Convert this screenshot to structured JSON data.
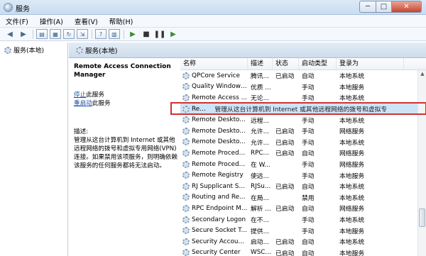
{
  "window": {
    "title": "服务",
    "min": "─",
    "max": "□",
    "close": "✕"
  },
  "menu": [
    "文件(F)",
    "操作(A)",
    "查看(V)",
    "帮助(H)"
  ],
  "toolbar": {
    "back": "◀",
    "forward": "▶",
    "start": "▶",
    "stop": "■",
    "pause": "❚❚",
    "restart": "▶"
  },
  "left_pane": {
    "node_label": "服务(本地)"
  },
  "right_pane": {
    "header": "服务(本地)"
  },
  "details": {
    "service_name": "Remote Access Connection Manager",
    "stop_link": "停止",
    "stop_suffix": "此服务",
    "restart_link": "重启动",
    "restart_suffix": "此服务",
    "desc_label": "描述:",
    "desc_text": "管理从这台计算机到 Internet 或其他远程网络的拨号和虚拟专用网络(VPN)连接。如果禁用该项服务，则明确依赖该服务的任何服务都将无法启动。"
  },
  "columns": [
    "名称",
    "描述",
    "状态",
    "启动类型",
    "登录为"
  ],
  "services": [
    {
      "name": "QPCore Service",
      "desc": "腾讯...",
      "status": "已启动",
      "startup": "自动",
      "login": "本地系统"
    },
    {
      "name": "Quality Windows...",
      "desc": "优质 ...",
      "status": "",
      "startup": "手动",
      "login": "本地服务"
    },
    {
      "name": "Remote Access ...",
      "desc": "无论...",
      "status": "",
      "startup": "手动",
      "login": "本地系统"
    },
    {
      "name": "Remote Access ...",
      "desc": "管理从这台计算机到 Internet 或其他远程网络的拨号和虚拟专",
      "status": "",
      "startup": "",
      "login": ""
    },
    {
      "name": "Remote Deskto...",
      "desc": "远程...",
      "status": "",
      "startup": "手动",
      "login": "本地系统"
    },
    {
      "name": "Remote Deskto...",
      "desc": "允许...",
      "status": "已启动",
      "startup": "手动",
      "login": "网络服务"
    },
    {
      "name": "Remote Deskto...",
      "desc": "允许...",
      "status": "已启动",
      "startup": "手动",
      "login": "本地系统"
    },
    {
      "name": "Remote Procedu...",
      "desc": "RPC...",
      "status": "已启动",
      "startup": "自动",
      "login": "网络服务"
    },
    {
      "name": "Remote Procedu...",
      "desc": "在 W...",
      "status": "",
      "startup": "手动",
      "login": "网络服务"
    },
    {
      "name": "Remote Registry",
      "desc": "使远...",
      "status": "",
      "startup": "手动",
      "login": "本地服务"
    },
    {
      "name": "RJ Supplicant Se...",
      "desc": "RJSu...",
      "status": "已启动",
      "startup": "自动",
      "login": "本地系统"
    },
    {
      "name": "Routing and Re...",
      "desc": "在局...",
      "status": "",
      "startup": "禁用",
      "login": "本地系统"
    },
    {
      "name": "RPC Endpoint M...",
      "desc": "解析 ...",
      "status": "已启动",
      "startup": "自动",
      "login": "网络服务"
    },
    {
      "name": "Secondary Logon",
      "desc": "在不...",
      "status": "",
      "startup": "手动",
      "login": "本地系统"
    },
    {
      "name": "Secure Socket T...",
      "desc": "提供...",
      "status": "",
      "startup": "手动",
      "login": "本地服务"
    },
    {
      "name": "Security Account...",
      "desc": "启动...",
      "status": "已启动",
      "startup": "自动",
      "login": "本地系统"
    },
    {
      "name": "Security Center",
      "desc": "WSC...",
      "status": "已启动",
      "startup": "自动",
      "login": "本地服务"
    }
  ],
  "colors": {
    "selection": "#cfe3f8",
    "highlight_border": "#cc3333",
    "link": "#1a4f9c"
  }
}
